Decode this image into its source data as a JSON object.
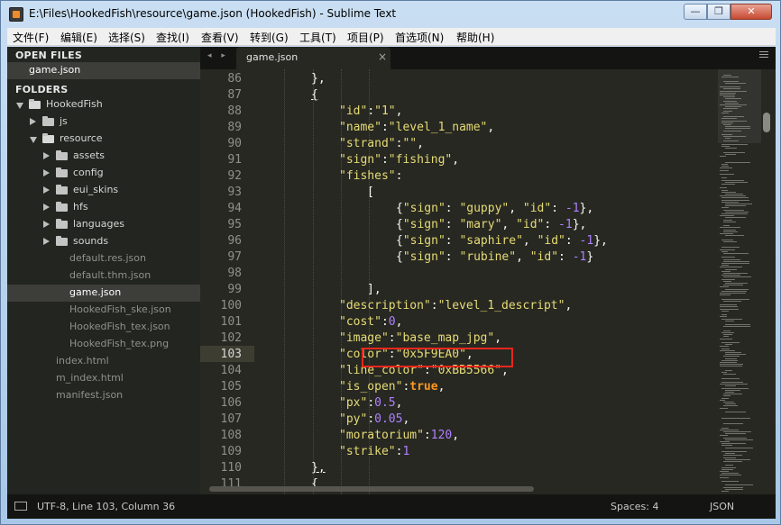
{
  "window": {
    "title": "E:\\Files\\HookedFish\\resource\\game.json (HookedFish) - Sublime Text",
    "minimize_glyph": "—",
    "maximize_glyph": "❐",
    "close_glyph": "✕"
  },
  "menu": [
    "文件(F)",
    "编辑(E)",
    "选择(S)",
    "查找(I)",
    "查看(V)",
    "转到(G)",
    "工具(T)",
    "项目(P)",
    "首选项(N)",
    "帮助(H)"
  ],
  "sidebar": {
    "open_files_header": "OPEN FILES",
    "open_files": [
      "game.json"
    ],
    "folders_header": "FOLDERS",
    "tree": [
      {
        "label": "HookedFish",
        "kind": "folder",
        "depth": 0,
        "expanded": true
      },
      {
        "label": "js",
        "kind": "folder",
        "depth": 1,
        "expanded": false
      },
      {
        "label": "resource",
        "kind": "folder",
        "depth": 1,
        "expanded": true
      },
      {
        "label": "assets",
        "kind": "folder",
        "depth": 2,
        "expanded": false
      },
      {
        "label": "config",
        "kind": "folder",
        "depth": 2,
        "expanded": false
      },
      {
        "label": "eui_skins",
        "kind": "folder",
        "depth": 2,
        "expanded": false
      },
      {
        "label": "hfs",
        "kind": "folder",
        "depth": 2,
        "expanded": false
      },
      {
        "label": "languages",
        "kind": "folder",
        "depth": 2,
        "expanded": false
      },
      {
        "label": "sounds",
        "kind": "folder",
        "depth": 2,
        "expanded": false
      },
      {
        "label": "default.res.json",
        "kind": "file",
        "depth": 2
      },
      {
        "label": "default.thm.json",
        "kind": "file",
        "depth": 2
      },
      {
        "label": "game.json",
        "kind": "file",
        "depth": 2,
        "selected": true
      },
      {
        "label": "HookedFish_ske.json",
        "kind": "file",
        "depth": 2
      },
      {
        "label": "HookedFish_tex.json",
        "kind": "file",
        "depth": 2
      },
      {
        "label": "HookedFish_tex.png",
        "kind": "file",
        "depth": 2
      },
      {
        "label": "index.html",
        "kind": "file",
        "depth": 1
      },
      {
        "label": "m_index.html",
        "kind": "file",
        "depth": 1
      },
      {
        "label": "manifest.json",
        "kind": "file",
        "depth": 1
      }
    ]
  },
  "tabs": {
    "nav_glyph": "◂ ▸",
    "active_label": "game.json",
    "close_glyph": "×"
  },
  "editor": {
    "current_line": 103,
    "highlighted_line": 103,
    "lines": [
      {
        "no": 86,
        "indent": 2,
        "tokens": [
          [
            "p",
            "},"
          ]
        ]
      },
      {
        "no": 87,
        "indent": 2,
        "tokens": [
          [
            "pu",
            "{"
          ]
        ]
      },
      {
        "no": 88,
        "indent": 3,
        "tokens": [
          [
            "s",
            "\"id\""
          ],
          [
            "p",
            ":"
          ],
          [
            "s",
            "\"1\""
          ],
          [
            "p",
            ","
          ]
        ]
      },
      {
        "no": 89,
        "indent": 3,
        "tokens": [
          [
            "s",
            "\"name\""
          ],
          [
            "p",
            ":"
          ],
          [
            "s",
            "\"level_1_name\""
          ],
          [
            "p",
            ","
          ]
        ]
      },
      {
        "no": 90,
        "indent": 3,
        "tokens": [
          [
            "s",
            "\"strand\""
          ],
          [
            "p",
            ":"
          ],
          [
            "s",
            "\"\""
          ],
          [
            "p",
            ","
          ]
        ]
      },
      {
        "no": 91,
        "indent": 3,
        "tokens": [
          [
            "s",
            "\"sign\""
          ],
          [
            "p",
            ":"
          ],
          [
            "s",
            "\"fishing\""
          ],
          [
            "p",
            ","
          ]
        ]
      },
      {
        "no": 92,
        "indent": 3,
        "tokens": [
          [
            "s",
            "\"fishes\""
          ],
          [
            "p",
            ":"
          ]
        ]
      },
      {
        "no": 93,
        "indent": 4,
        "tokens": [
          [
            "p",
            "["
          ]
        ]
      },
      {
        "no": 94,
        "indent": 5,
        "tokens": [
          [
            "p",
            "{"
          ],
          [
            "s",
            "\"sign\""
          ],
          [
            "p",
            ": "
          ],
          [
            "s",
            "\"guppy\""
          ],
          [
            "p",
            ", "
          ],
          [
            "s",
            "\"id\""
          ],
          [
            "p",
            ": "
          ],
          [
            "n",
            "-1"
          ],
          [
            "p",
            "},"
          ]
        ]
      },
      {
        "no": 95,
        "indent": 5,
        "tokens": [
          [
            "p",
            "{"
          ],
          [
            "s",
            "\"sign\""
          ],
          [
            "p",
            ": "
          ],
          [
            "s",
            "\"mary\""
          ],
          [
            "p",
            ", "
          ],
          [
            "s",
            "\"id\""
          ],
          [
            "p",
            ": "
          ],
          [
            "n",
            "-1"
          ],
          [
            "p",
            "},"
          ]
        ]
      },
      {
        "no": 96,
        "indent": 5,
        "tokens": [
          [
            "p",
            "{"
          ],
          [
            "s",
            "\"sign\""
          ],
          [
            "p",
            ": "
          ],
          [
            "s",
            "\"saphire\""
          ],
          [
            "p",
            ", "
          ],
          [
            "s",
            "\"id\""
          ],
          [
            "p",
            ": "
          ],
          [
            "n",
            "-1"
          ],
          [
            "p",
            "},"
          ]
        ]
      },
      {
        "no": 97,
        "indent": 5,
        "tokens": [
          [
            "p",
            "{"
          ],
          [
            "s",
            "\"sign\""
          ],
          [
            "p",
            ": "
          ],
          [
            "s",
            "\"rubine\""
          ],
          [
            "p",
            ", "
          ],
          [
            "s",
            "\"id\""
          ],
          [
            "p",
            ": "
          ],
          [
            "n",
            "-1"
          ],
          [
            "p",
            "}"
          ]
        ]
      },
      {
        "no": 98,
        "indent": 0,
        "tokens": []
      },
      {
        "no": 99,
        "indent": 4,
        "tokens": [
          [
            "p",
            "],"
          ]
        ]
      },
      {
        "no": 100,
        "indent": 3,
        "tokens": [
          [
            "s",
            "\"description\""
          ],
          [
            "p",
            ":"
          ],
          [
            "s",
            "\"level_1_descript\""
          ],
          [
            "p",
            ","
          ]
        ]
      },
      {
        "no": 101,
        "indent": 3,
        "tokens": [
          [
            "s",
            "\"cost\""
          ],
          [
            "p",
            ":"
          ],
          [
            "n",
            "0"
          ],
          [
            "p",
            ","
          ]
        ]
      },
      {
        "no": 102,
        "indent": 3,
        "tokens": [
          [
            "s",
            "\"image\""
          ],
          [
            "p",
            ":"
          ],
          [
            "s",
            "\"base_map_jpg\""
          ],
          [
            "p",
            ","
          ]
        ]
      },
      {
        "no": 103,
        "indent": 3,
        "tokens": [
          [
            "s",
            "\"color\""
          ],
          [
            "p",
            ":"
          ],
          [
            "s",
            "\"0x5F9EA0\""
          ],
          [
            "p",
            ","
          ]
        ]
      },
      {
        "no": 104,
        "indent": 3,
        "tokens": [
          [
            "s",
            "\"line_color\""
          ],
          [
            "p",
            ":"
          ],
          [
            "s",
            "\"0xBB5566\""
          ],
          [
            "p",
            ","
          ]
        ]
      },
      {
        "no": 105,
        "indent": 3,
        "tokens": [
          [
            "s",
            "\"is_open\""
          ],
          [
            "p",
            ":"
          ],
          [
            "k",
            "true"
          ],
          [
            "p",
            ","
          ]
        ]
      },
      {
        "no": 106,
        "indent": 3,
        "tokens": [
          [
            "s",
            "\"px\""
          ],
          [
            "p",
            ":"
          ],
          [
            "n",
            "0.5"
          ],
          [
            "p",
            ","
          ]
        ]
      },
      {
        "no": 107,
        "indent": 3,
        "tokens": [
          [
            "s",
            "\"py\""
          ],
          [
            "p",
            ":"
          ],
          [
            "n",
            "0.05"
          ],
          [
            "p",
            ","
          ]
        ]
      },
      {
        "no": 108,
        "indent": 3,
        "tokens": [
          [
            "s",
            "\"moratorium\""
          ],
          [
            "p",
            ":"
          ],
          [
            "n",
            "120"
          ],
          [
            "p",
            ","
          ]
        ]
      },
      {
        "no": 109,
        "indent": 3,
        "tokens": [
          [
            "s",
            "\"strike\""
          ],
          [
            "p",
            ":"
          ],
          [
            "n",
            "1"
          ]
        ]
      },
      {
        "no": 110,
        "indent": 2,
        "tokens": [
          [
            "pu",
            "},"
          ]
        ]
      },
      {
        "no": 111,
        "indent": 2,
        "tokens": [
          [
            "p",
            "{"
          ]
        ]
      }
    ]
  },
  "status": {
    "left": "UTF-8, Line 103, Column 36",
    "spaces": "Spaces: 4",
    "syntax": "JSON"
  },
  "colors": {
    "string": "#e6db74",
    "keyword": "#fd971f",
    "number": "#ae81ff",
    "highlight_box": "#e8261d"
  }
}
